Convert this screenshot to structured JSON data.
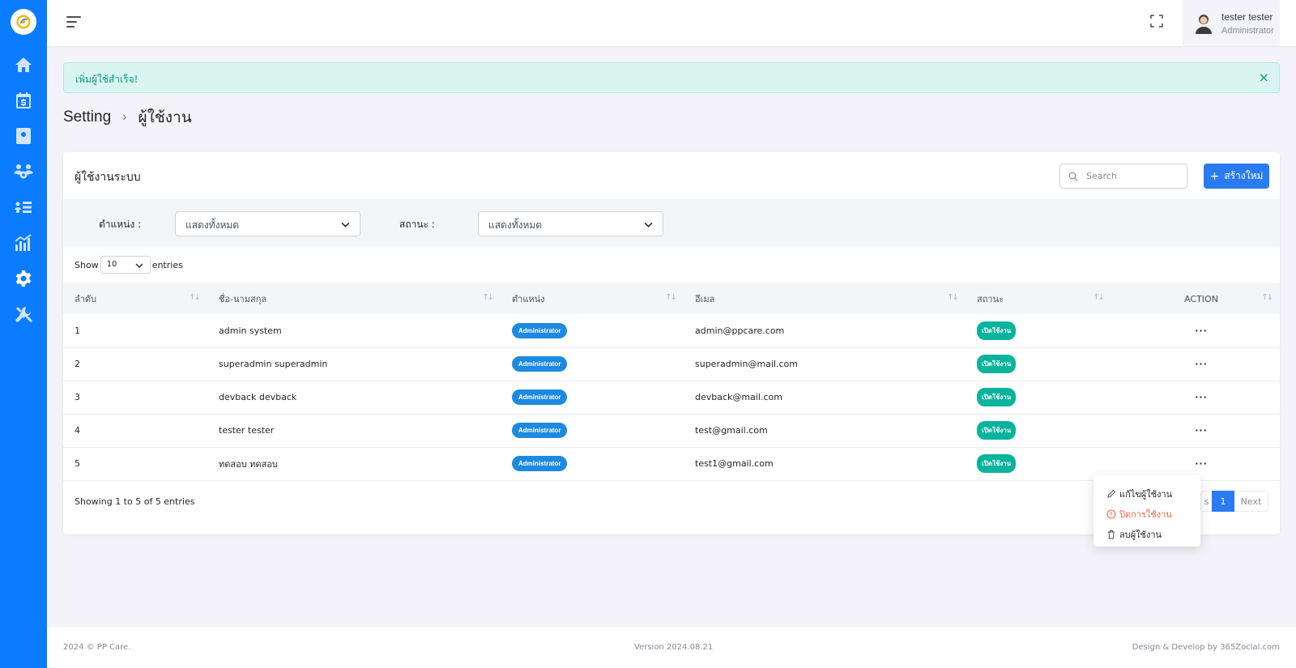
{
  "sidebar": {
    "items": [
      {
        "icon": "home-icon"
      },
      {
        "icon": "calendar-dollar-icon"
      },
      {
        "icon": "contact-book-icon"
      },
      {
        "icon": "users-gear-icon"
      },
      {
        "icon": "list-users-icon"
      },
      {
        "icon": "chart-bar-icon"
      },
      {
        "icon": "gear-icon",
        "active": true
      },
      {
        "icon": "tools-icon"
      }
    ]
  },
  "user": {
    "name": "tester tester",
    "role": "Administrator"
  },
  "alert": {
    "text": "เพิ่มผู้ใช้สำเร็จ!",
    "close": "×"
  },
  "breadcrumb": {
    "root": "Setting",
    "separator": "›",
    "current": "ผู้ใช้งาน"
  },
  "card": {
    "title": "ผู้ใช้งานระบบ",
    "search_placeholder": "Search",
    "create_label": "สร้างใหม่",
    "create_icon": "+"
  },
  "filters": {
    "position_label": "ตำแหน่ง :",
    "position_value": "แสดงทั้งหมด",
    "status_label": "สถานะ :",
    "status_value": "แสดงทั้งหมด"
  },
  "length": {
    "show": "Show",
    "value": "10",
    "entries": "entries"
  },
  "table": {
    "headers": [
      "ลำดับ",
      "ชื่อ-นามสกุล",
      "ตำแหน่ง",
      "อีเมล",
      "สถานะ",
      "ACTION"
    ],
    "rows": [
      {
        "no": "1",
        "name": "admin system",
        "role": "Administrator",
        "email": "admin@ppcare.com",
        "status": "เปิดใช้งาน",
        "action": "···"
      },
      {
        "no": "2",
        "name": "superadmin superadmin",
        "role": "Administrator",
        "email": "superadmin@mail.com",
        "status": "เปิดใช้งาน",
        "action": "···"
      },
      {
        "no": "3",
        "name": "devback devback",
        "role": "Administrator",
        "email": "devback@mail.com",
        "status": "เปิดใช้งาน",
        "action": "···"
      },
      {
        "no": "4",
        "name": "tester tester",
        "role": "Administrator",
        "email": "test@gmail.com",
        "status": "เปิดใช้งาน",
        "action": "···"
      },
      {
        "no": "5",
        "name": "ทดสอบ ทดสอบ",
        "role": "Administrator",
        "email": "test1@gmail.com",
        "status": "เปิดใช้งาน",
        "action": "···"
      }
    ]
  },
  "info": "Showing 1 to 5 of 5 entries",
  "pagination": {
    "prev": "s",
    "current": "1",
    "next": "Next"
  },
  "dropdown": {
    "edit": "แก้ไขผู้ใช้งาน",
    "disable": "ปิดการใช้งาน",
    "delete": "ลบผู้ใช้งาน"
  },
  "footer": {
    "copyright": "2024 © PP Care.",
    "version": "Version 2024.08.21",
    "credit": "Design & Develop by 365Zocial.com"
  },
  "colors": {
    "primary": "#0b7cff",
    "button": "#2a7bf0",
    "success": "#0ab39c",
    "danger": "#f06548"
  }
}
